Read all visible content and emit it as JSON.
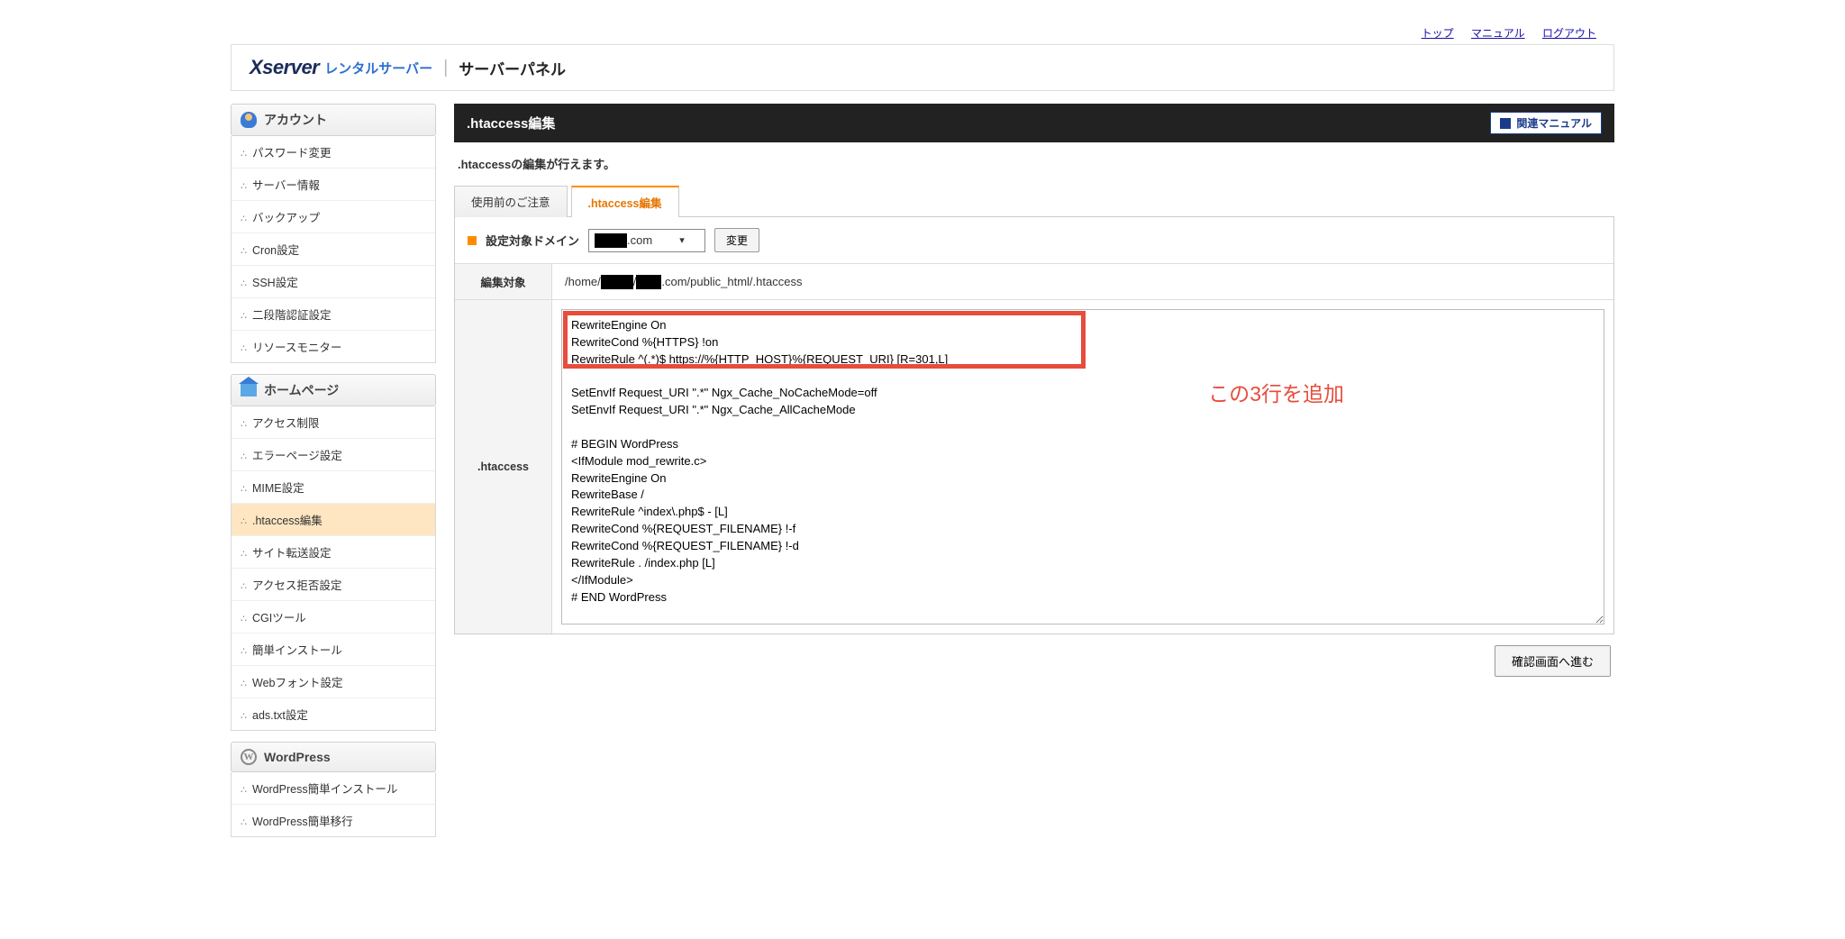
{
  "topnav": {
    "top": "トップ",
    "manual": "マニュアル",
    "logout": "ログアウト"
  },
  "logo": {
    "brand": "Xserver",
    "rental": "レンタルサーバー",
    "panel": "サーバーパネル"
  },
  "sidebar": {
    "account": {
      "title": "アカウント",
      "items": [
        "パスワード変更",
        "サーバー情報",
        "バックアップ",
        "Cron設定",
        "SSH設定",
        "二段階認証設定",
        "リソースモニター"
      ]
    },
    "homepage": {
      "title": "ホームページ",
      "items": [
        "アクセス制限",
        "エラーページ設定",
        "MIME設定",
        ".htaccess編集",
        "サイト転送設定",
        "アクセス拒否設定",
        "CGIツール",
        "簡単インストール",
        "Webフォント設定",
        "ads.txt設定"
      ],
      "active_index": 3
    },
    "wordpress": {
      "title": "WordPress",
      "items": [
        "WordPress簡単インストール",
        "WordPress簡単移行"
      ]
    }
  },
  "page": {
    "title": ".htaccess編集",
    "manual_btn": "関連マニュアル",
    "desc": ".htaccessの編集が行えます。",
    "tabs": {
      "notice": "使用前のご注意",
      "edit": ".htaccess編集"
    },
    "domain_label": "設定対象ドメイン",
    "domain_suffix": ".com",
    "change_btn": "変更",
    "target_label": "編集対象",
    "target_path_prefix": "/home/",
    "target_path_mid": "/",
    "target_path_suffix": ".com/public_html/.htaccess",
    "htaccess_label": ".htaccess",
    "htaccess_content": "RewriteEngine On\nRewriteCond %{HTTPS} !on\nRewriteRule ^(.*)$ https://%{HTTP_HOST}%{REQUEST_URI} [R=301,L]\n\nSetEnvIf Request_URI \".*\" Ngx_Cache_NoCacheMode=off\nSetEnvIf Request_URI \".*\" Ngx_Cache_AllCacheMode\n\n# BEGIN WordPress\n<IfModule mod_rewrite.c>\nRewriteEngine On\nRewriteBase /\nRewriteRule ^index\\.php$ - [L]\nRewriteCond %{REQUEST_FILENAME} !-f\nRewriteCond %{REQUEST_FILENAME} !-d\nRewriteRule . /index.php [L]\n</IfModule>\n# END WordPress",
    "confirm_btn": "確認画面へ進む"
  },
  "annotation": "この3行を追加"
}
